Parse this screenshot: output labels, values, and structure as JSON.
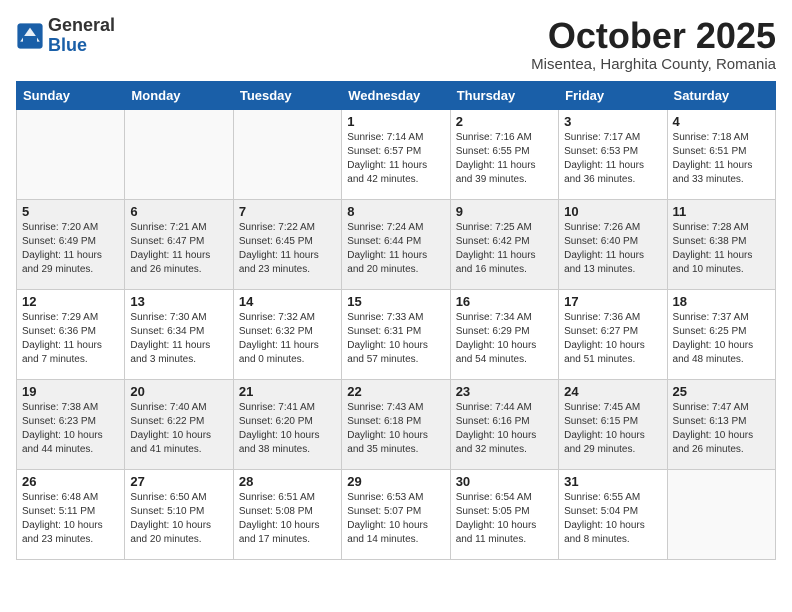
{
  "header": {
    "logo_general": "General",
    "logo_blue": "Blue",
    "month": "October 2025",
    "location": "Misentea, Harghita County, Romania"
  },
  "days_of_week": [
    "Sunday",
    "Monday",
    "Tuesday",
    "Wednesday",
    "Thursday",
    "Friday",
    "Saturday"
  ],
  "weeks": [
    [
      {
        "day": "",
        "info": ""
      },
      {
        "day": "",
        "info": ""
      },
      {
        "day": "",
        "info": ""
      },
      {
        "day": "1",
        "info": "Sunrise: 7:14 AM\nSunset: 6:57 PM\nDaylight: 11 hours\nand 42 minutes."
      },
      {
        "day": "2",
        "info": "Sunrise: 7:16 AM\nSunset: 6:55 PM\nDaylight: 11 hours\nand 39 minutes."
      },
      {
        "day": "3",
        "info": "Sunrise: 7:17 AM\nSunset: 6:53 PM\nDaylight: 11 hours\nand 36 minutes."
      },
      {
        "day": "4",
        "info": "Sunrise: 7:18 AM\nSunset: 6:51 PM\nDaylight: 11 hours\nand 33 minutes."
      }
    ],
    [
      {
        "day": "5",
        "info": "Sunrise: 7:20 AM\nSunset: 6:49 PM\nDaylight: 11 hours\nand 29 minutes."
      },
      {
        "day": "6",
        "info": "Sunrise: 7:21 AM\nSunset: 6:47 PM\nDaylight: 11 hours\nand 26 minutes."
      },
      {
        "day": "7",
        "info": "Sunrise: 7:22 AM\nSunset: 6:45 PM\nDaylight: 11 hours\nand 23 minutes."
      },
      {
        "day": "8",
        "info": "Sunrise: 7:24 AM\nSunset: 6:44 PM\nDaylight: 11 hours\nand 20 minutes."
      },
      {
        "day": "9",
        "info": "Sunrise: 7:25 AM\nSunset: 6:42 PM\nDaylight: 11 hours\nand 16 minutes."
      },
      {
        "day": "10",
        "info": "Sunrise: 7:26 AM\nSunset: 6:40 PM\nDaylight: 11 hours\nand 13 minutes."
      },
      {
        "day": "11",
        "info": "Sunrise: 7:28 AM\nSunset: 6:38 PM\nDaylight: 11 hours\nand 10 minutes."
      }
    ],
    [
      {
        "day": "12",
        "info": "Sunrise: 7:29 AM\nSunset: 6:36 PM\nDaylight: 11 hours\nand 7 minutes."
      },
      {
        "day": "13",
        "info": "Sunrise: 7:30 AM\nSunset: 6:34 PM\nDaylight: 11 hours\nand 3 minutes."
      },
      {
        "day": "14",
        "info": "Sunrise: 7:32 AM\nSunset: 6:32 PM\nDaylight: 11 hours\nand 0 minutes."
      },
      {
        "day": "15",
        "info": "Sunrise: 7:33 AM\nSunset: 6:31 PM\nDaylight: 10 hours\nand 57 minutes."
      },
      {
        "day": "16",
        "info": "Sunrise: 7:34 AM\nSunset: 6:29 PM\nDaylight: 10 hours\nand 54 minutes."
      },
      {
        "day": "17",
        "info": "Sunrise: 7:36 AM\nSunset: 6:27 PM\nDaylight: 10 hours\nand 51 minutes."
      },
      {
        "day": "18",
        "info": "Sunrise: 7:37 AM\nSunset: 6:25 PM\nDaylight: 10 hours\nand 48 minutes."
      }
    ],
    [
      {
        "day": "19",
        "info": "Sunrise: 7:38 AM\nSunset: 6:23 PM\nDaylight: 10 hours\nand 44 minutes."
      },
      {
        "day": "20",
        "info": "Sunrise: 7:40 AM\nSunset: 6:22 PM\nDaylight: 10 hours\nand 41 minutes."
      },
      {
        "day": "21",
        "info": "Sunrise: 7:41 AM\nSunset: 6:20 PM\nDaylight: 10 hours\nand 38 minutes."
      },
      {
        "day": "22",
        "info": "Sunrise: 7:43 AM\nSunset: 6:18 PM\nDaylight: 10 hours\nand 35 minutes."
      },
      {
        "day": "23",
        "info": "Sunrise: 7:44 AM\nSunset: 6:16 PM\nDaylight: 10 hours\nand 32 minutes."
      },
      {
        "day": "24",
        "info": "Sunrise: 7:45 AM\nSunset: 6:15 PM\nDaylight: 10 hours\nand 29 minutes."
      },
      {
        "day": "25",
        "info": "Sunrise: 7:47 AM\nSunset: 6:13 PM\nDaylight: 10 hours\nand 26 minutes."
      }
    ],
    [
      {
        "day": "26",
        "info": "Sunrise: 6:48 AM\nSunset: 5:11 PM\nDaylight: 10 hours\nand 23 minutes."
      },
      {
        "day": "27",
        "info": "Sunrise: 6:50 AM\nSunset: 5:10 PM\nDaylight: 10 hours\nand 20 minutes."
      },
      {
        "day": "28",
        "info": "Sunrise: 6:51 AM\nSunset: 5:08 PM\nDaylight: 10 hours\nand 17 minutes."
      },
      {
        "day": "29",
        "info": "Sunrise: 6:53 AM\nSunset: 5:07 PM\nDaylight: 10 hours\nand 14 minutes."
      },
      {
        "day": "30",
        "info": "Sunrise: 6:54 AM\nSunset: 5:05 PM\nDaylight: 10 hours\nand 11 minutes."
      },
      {
        "day": "31",
        "info": "Sunrise: 6:55 AM\nSunset: 5:04 PM\nDaylight: 10 hours\nand 8 minutes."
      },
      {
        "day": "",
        "info": ""
      }
    ]
  ]
}
